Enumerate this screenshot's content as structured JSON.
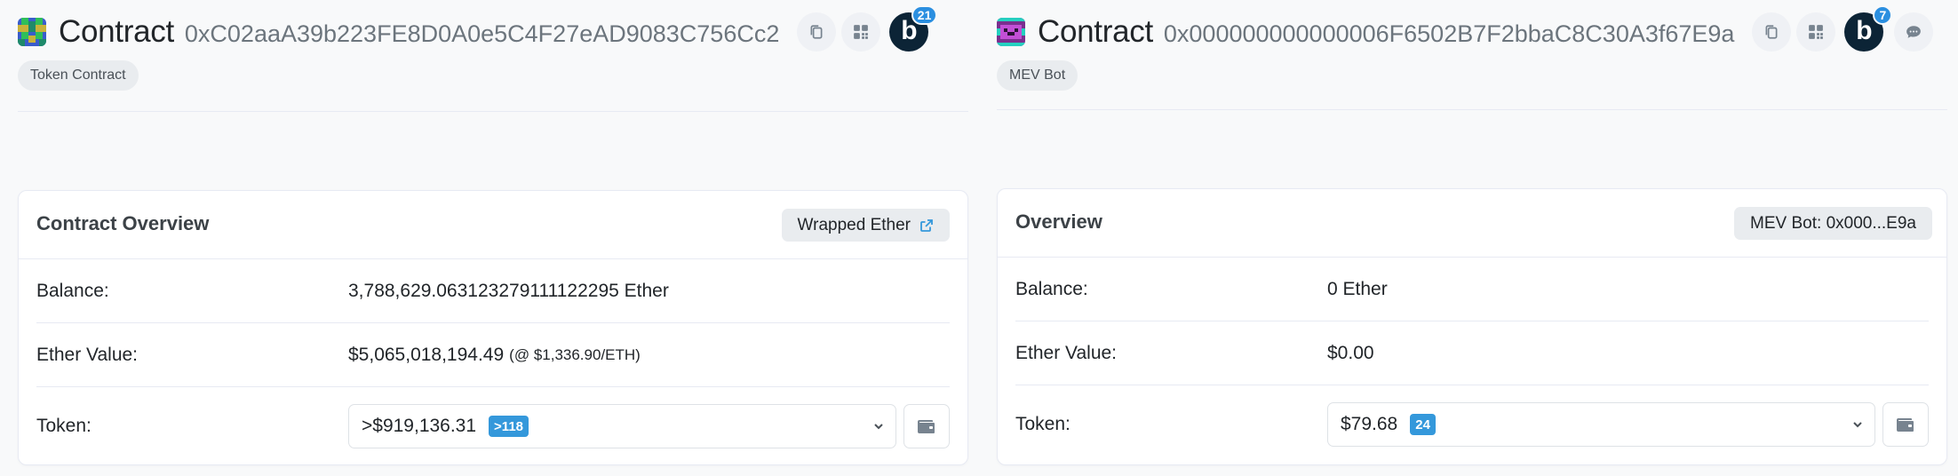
{
  "left": {
    "header": {
      "title": "Contract",
      "address": "0xC02aaA39b223FE8D0A0e5C4F27eAD9083C756Cc2",
      "blockscan_badge": "21",
      "tag": "Token Contract",
      "avatar_icon": "identicon-green-blue"
    },
    "overview": {
      "title": "Contract Overview",
      "link_label": "Wrapped Ether",
      "balance_label": "Balance:",
      "balance_value": "3,788,629.063123279111122295 Ether",
      "ether_value_label": "Ether Value:",
      "ether_value": "$5,065,018,194.49",
      "ether_rate": "(@ $1,336.90/ETH)",
      "token_label": "Token:",
      "token_amount": ">$919,136.31",
      "token_count": ">118"
    }
  },
  "right": {
    "header": {
      "title": "Contract",
      "address": "0x000000000000006F6502B7F2bbaC8C30A3f67E9a",
      "blockscan_badge": "7",
      "tag": "MEV Bot",
      "avatar_icon": "identicon-purple-teal"
    },
    "overview": {
      "title": "Overview",
      "link_label": "MEV Bot: 0x000...E9a",
      "balance_label": "Balance:",
      "balance_value": "0 Ether",
      "ether_value_label": "Ether Value:",
      "ether_value": "$0.00",
      "token_label": "Token:",
      "token_amount": "$79.68",
      "token_count": "24"
    }
  },
  "colors": {
    "accent": "#3498db",
    "blockscan_dark": "#0c2436",
    "muted_text": "#6c757d"
  }
}
